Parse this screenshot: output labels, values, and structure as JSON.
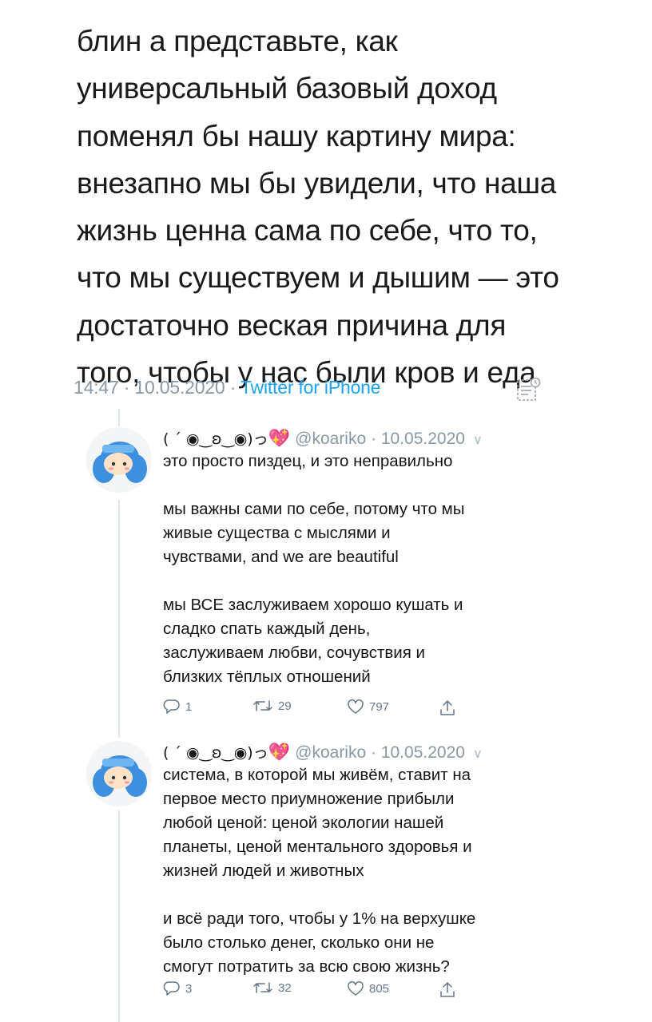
{
  "main_tweet": {
    "text": "блин а представьте, как\nуниверсальный базовый доход\nпоменял бы нашу картину мира:\nвнезапно мы бы увидели, что наша\nжизнь ценна сама по себе, что то,\nчто мы существуем и дышим — это\nдостаточно веская причина для\nтого, чтобы у нас были кров и еда",
    "time": "14:47",
    "date": "10.05.2020",
    "source": "Twitter for iPhone",
    "separator": " · "
  },
  "replies": [
    {
      "display_name": "( ´ ◉‿ʚ‿◉)っ",
      "emoji": "💖",
      "handle": "@koariko",
      "date": "· 10.05.2020",
      "text": "это просто пиздец, и это неправильно\n\nмы важны сами по себе, потому что мы\nживые существа с мыслями и\nчувствами, and we are beautiful\n\nмы ВСЕ заслуживаем хорошо кушать и\nсладко спать каждый день,\nзаслуживаем любви, сочувствия и\nблизких тёплых отношений",
      "replies_count": "1",
      "retweets_count": "29",
      "likes_count": "797"
    },
    {
      "display_name": "( ´ ◉‿ʚ‿◉)っ",
      "emoji": "💖",
      "handle": "@koariko",
      "date": "· 10.05.2020",
      "text": "система, в которой мы живём, ставит на\nпервое место приумножение прибыли\nлюбой ценой: ценой экологии нашей\nпланеты, ценой ментального здоровья и\nжизней людей и животных\n\nи всё ради того, чтобы у 1% на верхушке\nбыло столько денег, сколько они не\nсмогут потратить за всю свою жизнь?",
      "replies_count": "3",
      "retweets_count": "32",
      "likes_count": "805"
    }
  ],
  "icons": {
    "reply": "reply-icon",
    "retweet": "retweet-icon",
    "like": "heart-icon",
    "share": "share-icon",
    "analytics": "analytics-icon",
    "more": "chevron-down-icon"
  },
  "colors": {
    "accent": "#1da1f2",
    "muted": "#8899a6",
    "avatar_hair": "#3d8fe0",
    "heart": "#e0457b"
  }
}
